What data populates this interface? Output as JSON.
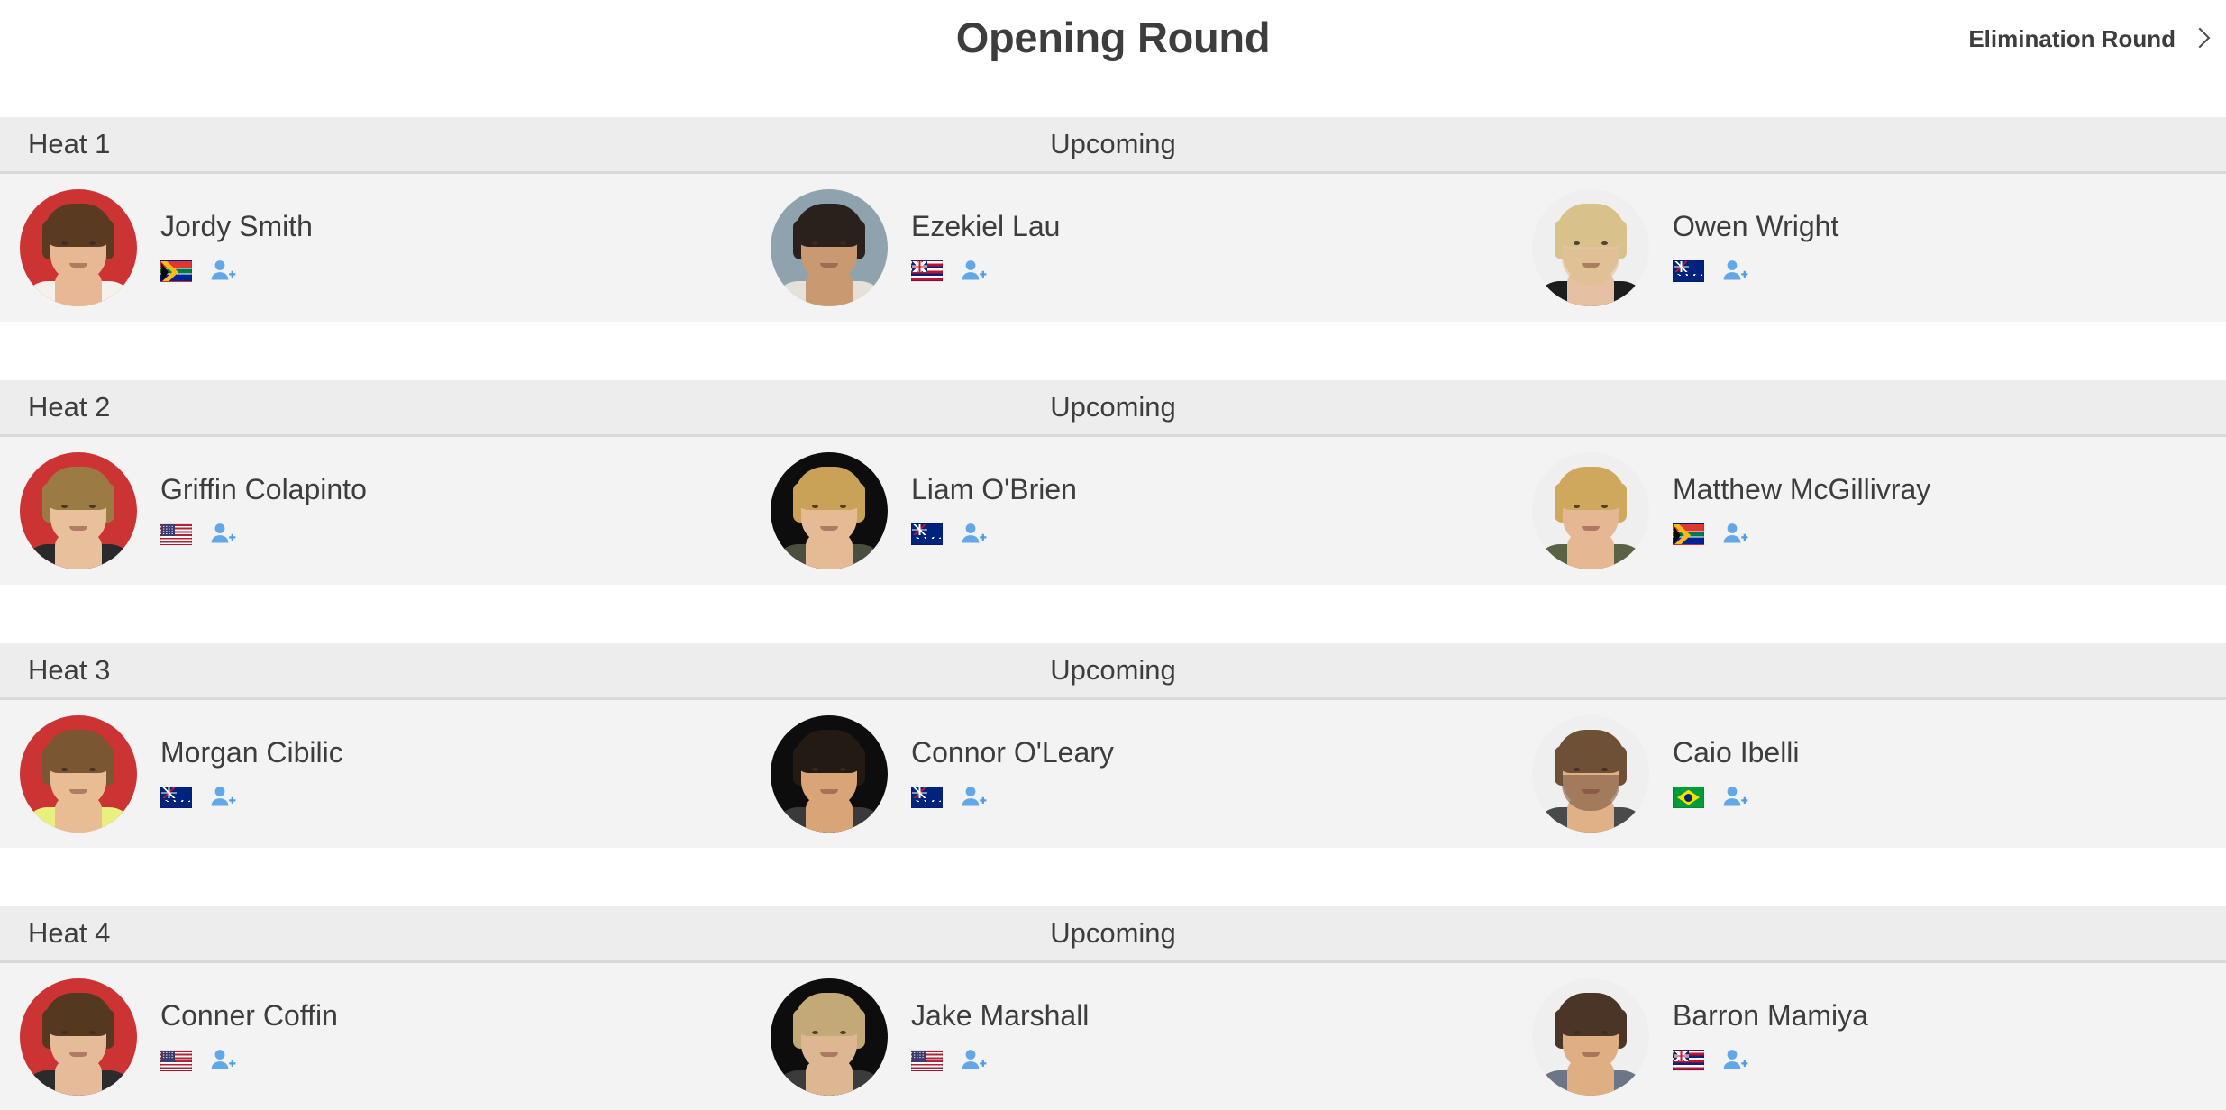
{
  "header": {
    "title": "Opening Round",
    "next_round_label": "Elimination Round",
    "chevron_icon": "chevron-right-icon"
  },
  "icons": {
    "add_person": "add-person-icon"
  },
  "colors": {
    "header_band": "#ededed",
    "row_background": "#f3f3f3",
    "page_background": "#ffffff",
    "text": "#3d3d3d",
    "divider": "#d9d9d9",
    "add_person_blue": "#62a8e8",
    "seed_avatar_red": "#cc3333"
  },
  "heats": [
    {
      "label": "Heat 1",
      "status": "Upcoming",
      "athletes": [
        {
          "name": "Jordy Smith",
          "flag": "zaf",
          "flag_name": "south-africa-flag",
          "bg": "#cc3333",
          "skin": "#e8b894",
          "hair": "#5b3a22",
          "shirt": "#f5f2ec",
          "beard": false
        },
        {
          "name": "Ezekiel Lau",
          "flag": "hi",
          "flag_name": "hawaii-flag",
          "bg": "#8fa3ae",
          "skin": "#c99a72",
          "hair": "#2a211c",
          "shirt": "#e5e0d8",
          "beard": false
        },
        {
          "name": "Owen Wright",
          "flag": "aus",
          "flag_name": "australia-flag",
          "bg": "#efefef",
          "skin": "#e6c0a2",
          "hair": "#d8c18a",
          "shirt": "#1d1d1d",
          "beard": true
        }
      ]
    },
    {
      "label": "Heat 2",
      "status": "Upcoming",
      "athletes": [
        {
          "name": "Griffin Colapinto",
          "flag": "usa",
          "flag_name": "usa-flag",
          "bg": "#cc3333",
          "skin": "#e8c09c",
          "hair": "#9c7a44",
          "shirt": "#2a2a2a",
          "beard": false
        },
        {
          "name": "Liam O'Brien",
          "flag": "aus",
          "flag_name": "australia-flag",
          "bg": "#0d0d0d",
          "skin": "#e4bb95",
          "hair": "#c9a257",
          "shirt": "#4b4f3f",
          "beard": false
        },
        {
          "name": "Matthew McGillivray",
          "flag": "zaf",
          "flag_name": "south-africa-flag",
          "bg": "#efefef",
          "skin": "#e5b793",
          "hair": "#cfa85e",
          "shirt": "#5a6246",
          "beard": false
        }
      ]
    },
    {
      "label": "Heat 3",
      "status": "Upcoming",
      "athletes": [
        {
          "name": "Morgan Cibilic",
          "flag": "aus",
          "flag_name": "australia-flag",
          "bg": "#cc3333",
          "skin": "#e9bd93",
          "hair": "#7a5632",
          "shirt": "#e9f07e",
          "beard": false
        },
        {
          "name": "Connor O'Leary",
          "flag": "aus",
          "flag_name": "australia-flag",
          "bg": "#0d0d0d",
          "skin": "#d9a476",
          "hair": "#231a14",
          "shirt": "#3a3a3a",
          "beard": false
        },
        {
          "name": "Caio Ibelli",
          "flag": "bra",
          "flag_name": "brazil-flag",
          "bg": "#efefef",
          "skin": "#e0b087",
          "hair": "#6e5036",
          "shirt": "#4a4a4a",
          "beard": true
        }
      ]
    },
    {
      "label": "Heat 4",
      "status": "Upcoming",
      "athletes": [
        {
          "name": "Conner Coffin",
          "flag": "usa",
          "flag_name": "usa-flag",
          "bg": "#cc3333",
          "skin": "#e6bb9a",
          "hair": "#54381f",
          "shirt": "#2b2b2b",
          "beard": false
        },
        {
          "name": "Jake Marshall",
          "flag": "usa",
          "flag_name": "usa-flag",
          "bg": "#0d0d0d",
          "skin": "#dcb791",
          "hair": "#c3a878",
          "shirt": "#3b3b3b",
          "beard": false
        },
        {
          "name": "Barron Mamiya",
          "flag": "hi",
          "flag_name": "hawaii-flag",
          "bg": "#efefef",
          "skin": "#dfae82",
          "hair": "#4a3526",
          "shirt": "#6d7686",
          "beard": false
        }
      ]
    }
  ]
}
